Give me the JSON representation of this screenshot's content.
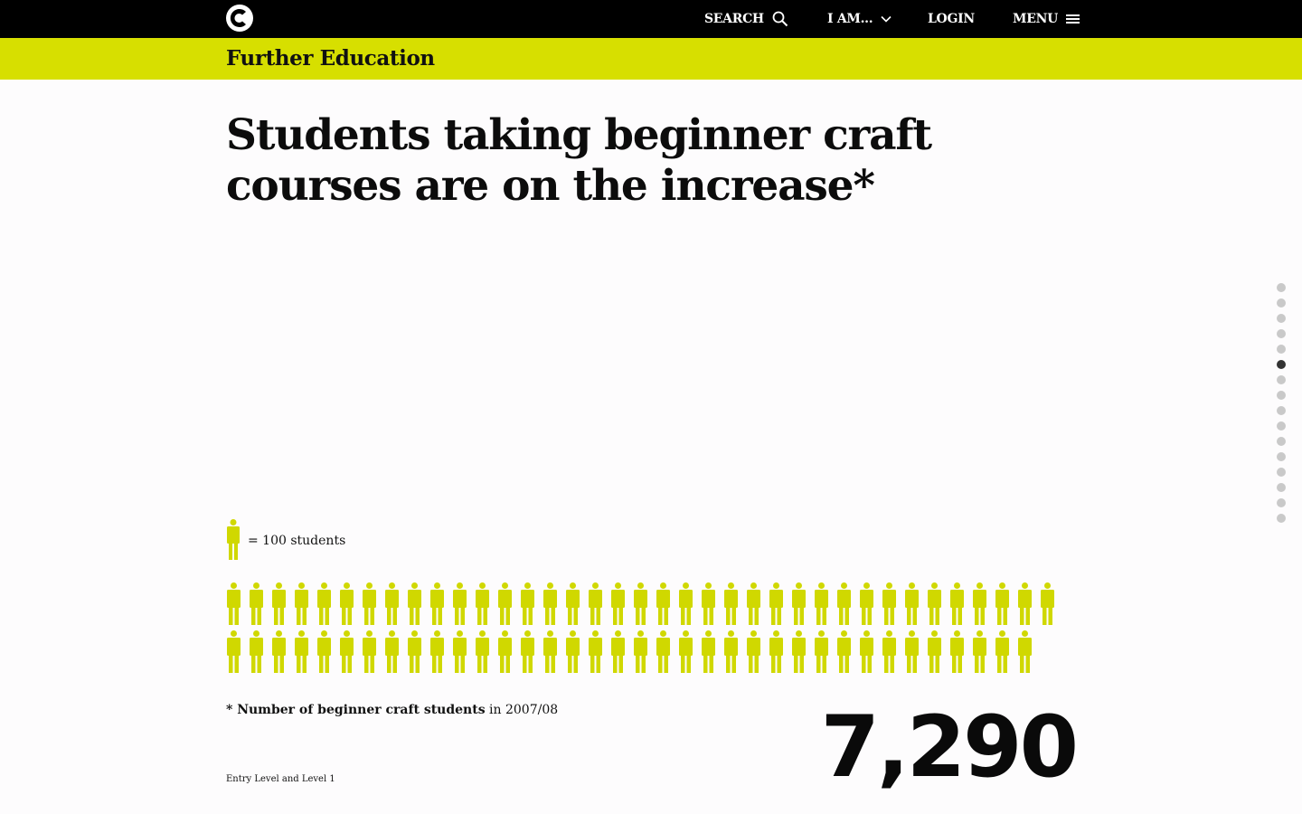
{
  "nav": {
    "search_label": "SEARCH",
    "i_am_label": "I AM...",
    "login_label": "LOGIN",
    "menu_label": "MENU"
  },
  "section": {
    "title": "Further Education"
  },
  "headline": "Students taking beginner craft courses are on the increase*",
  "pager": {
    "total": 16,
    "active_index": 5
  },
  "legend": {
    "text": "= 100 students",
    "icon": "person-icon"
  },
  "chart_data": {
    "type": "pictogram",
    "unit_label": "= 100 students",
    "unit_value": 100,
    "icon_count": 73,
    "total": 7290
  },
  "footnote": {
    "bold": "* Number of beginner craft students",
    "rest": " in 2007/08"
  },
  "note": "Entry Level and Level 1",
  "big_number": "7,290",
  "colors": {
    "accent": "#d7df00",
    "header_bg": "#000000",
    "figure": "#d0d800"
  }
}
